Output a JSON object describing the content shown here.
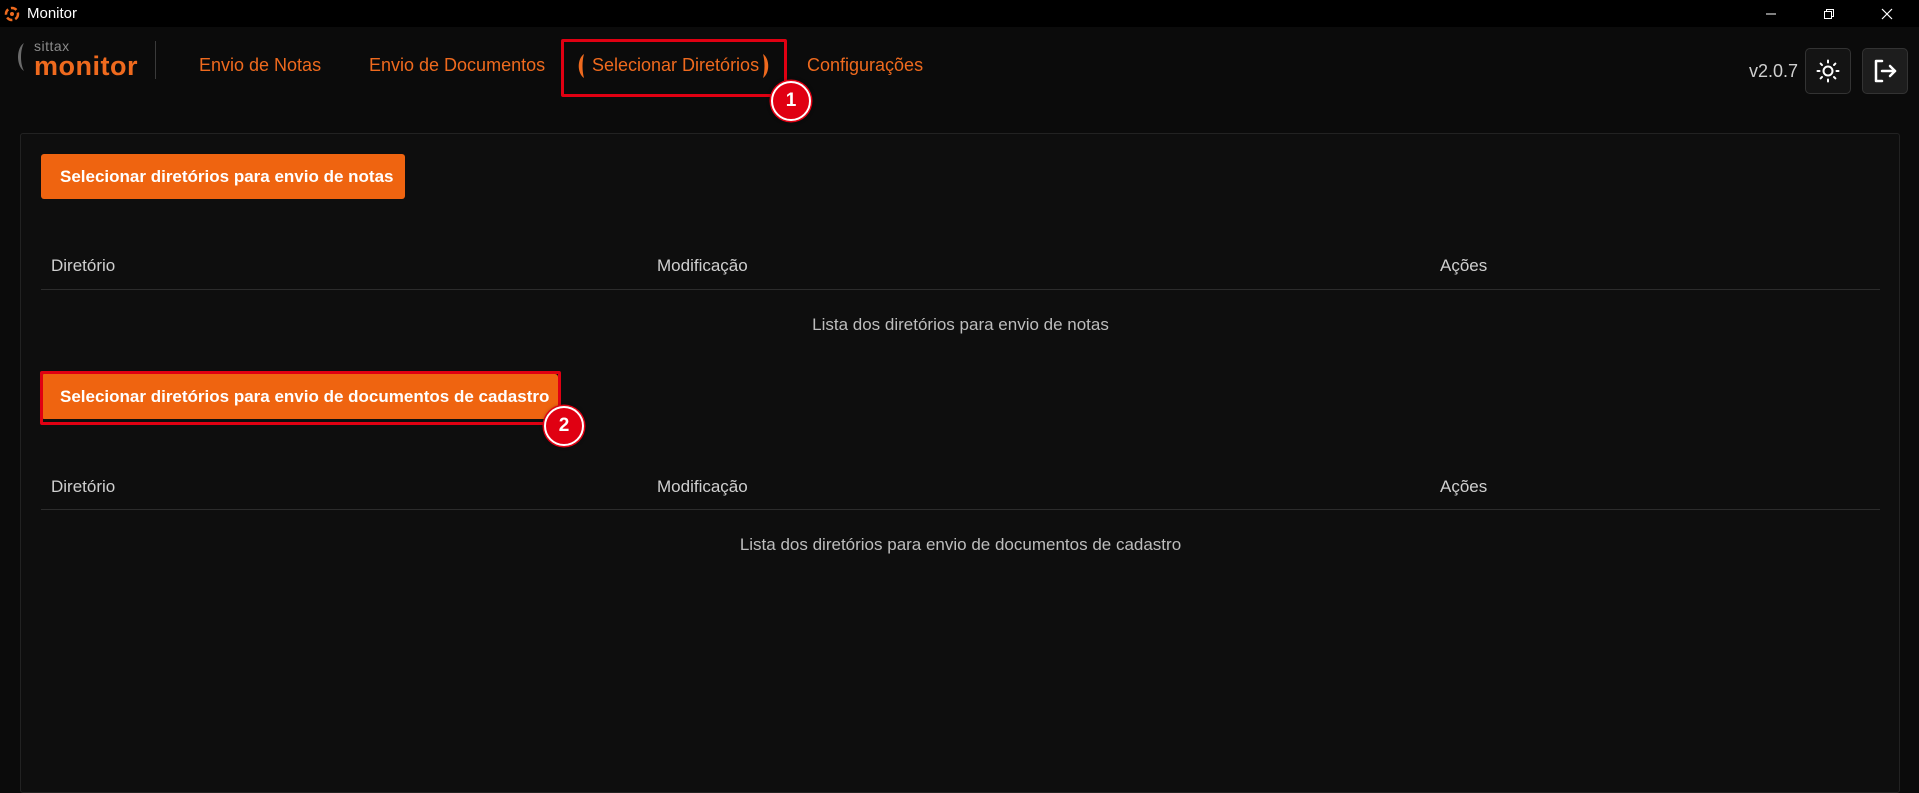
{
  "window": {
    "title": "Monitor"
  },
  "logo": {
    "small": "sittax",
    "big": "monitor"
  },
  "nav": {
    "items": [
      {
        "label": "Envio de Notas"
      },
      {
        "label": "Envio de Documentos"
      },
      {
        "label": "Selecionar Diretórios"
      },
      {
        "label": "Configurações"
      }
    ]
  },
  "header": {
    "version": "v2.0.7"
  },
  "annotations": {
    "badge1": "1",
    "badge2": "2",
    "highlight_color": "#e00012"
  },
  "notas": {
    "button_label": "Selecionar diretórios para envio de notas",
    "columns": [
      "Diretório",
      "Modificação",
      "Ações"
    ],
    "empty_text": "Lista dos diretórios para envio de notas"
  },
  "documentos": {
    "button_label": "Selecionar diretórios para envio de documentos de cadastro",
    "columns": [
      "Diretório",
      "Modificação",
      "Ações"
    ],
    "empty_text": "Lista dos diretórios para envio de documentos de cadastro"
  },
  "colors": {
    "accent": "#ef6a1e",
    "button": "#ef6410",
    "background": "#0b0b0b"
  },
  "icons": [
    "app-logo-icon",
    "minimize-icon",
    "restore-icon",
    "close-icon",
    "sun-icon",
    "logout-icon"
  ]
}
